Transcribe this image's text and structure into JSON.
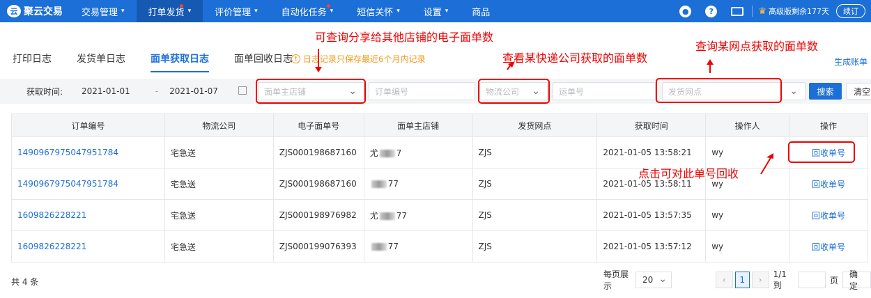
{
  "nav": {
    "logo": "聚云交易",
    "items": [
      {
        "label": "交易管理",
        "caret": "▾",
        "dot": false
      },
      {
        "label": "打单发货",
        "caret": "▾",
        "dot": true
      },
      {
        "label": "评价管理",
        "caret": "▾",
        "dot": false
      },
      {
        "label": "自动化任务",
        "caret": "▾",
        "dot": true
      },
      {
        "label": "短信关怀",
        "caret": "▾",
        "dot": false
      },
      {
        "label": "设置",
        "caret": "▾",
        "dot": false
      },
      {
        "label": "商品",
        "caret": "",
        "dot": false
      }
    ],
    "vip_text": "高级版剩余177天",
    "renew_label": "续订",
    "help_glyph": "?"
  },
  "tabs": [
    "打印日志",
    "发货单日志",
    "面单获取日志",
    "面单回收日志"
  ],
  "notice": "日志记录只保存最近6个月内记录",
  "generate_bill": "生成账单",
  "filters": {
    "time_label": "获取时间:",
    "date_start": "2021-01-01",
    "date_sep": "-",
    "date_end": "2021-01-07",
    "shop_placeholder": "面单主店铺",
    "order_placeholder": "订单编号",
    "logistics_placeholder": "物流公司",
    "waybill_placeholder": "运单号",
    "outlet_placeholder": "发货网点",
    "search_label": "搜索",
    "clear_label": "清空"
  },
  "table": {
    "headers": [
      "订单编号",
      "物流公司",
      "电子面单号",
      "面单主店铺",
      "发货网点",
      "获取时间",
      "操作人",
      "操作"
    ],
    "rows": [
      {
        "order": "1490967975047951784",
        "logistics": "宅急送",
        "waybill": "ZJS000198687160",
        "shop_a": "尤",
        "shop_b": "7",
        "outlet": "ZJS",
        "time": "2021-01-05 13:58:21",
        "operator": "wy",
        "action": "回收单号"
      },
      {
        "order": "1490967975047951784",
        "logistics": "宅急送",
        "waybill": "ZJS000198687160",
        "shop_a": "",
        "shop_b": "77",
        "outlet": "ZJS",
        "time": "2021-01-05 13:58:11",
        "operator": "wy",
        "action": "回收单号"
      },
      {
        "order": "1609826228221",
        "logistics": "宅急送",
        "waybill": "ZJS000198976982",
        "shop_a": "尤",
        "shop_b": "77",
        "outlet": "ZJS",
        "time": "2021-01-05 13:57:35",
        "operator": "wy",
        "action": "回收单号"
      },
      {
        "order": "1609826228221",
        "logistics": "宅急送",
        "waybill": "ZJS000199076393",
        "shop_a": "",
        "shop_b": "77",
        "outlet": "ZJS",
        "time": "2021-01-05 13:57:12",
        "operator": "wy",
        "action": "回收单号"
      }
    ]
  },
  "footer": {
    "total": "共 4 条",
    "per_page_label": "每页展示",
    "per_page_value": "20",
    "current_page": "1",
    "page_info": "1/1 到",
    "page_suffix": "页",
    "confirm_label": "确定"
  },
  "annotations": {
    "shop_note": "可查询分享给其他店铺的电子面单数",
    "logistics_note": "查看某快递公司获取的面单数",
    "outlet_note": "查询某网点获取的面单数",
    "recycle_note": "点击可对此单号回收",
    "color": "#e00000"
  },
  "colors": {
    "primary": "#1c6fd6",
    "warning": "#f39b1c"
  }
}
